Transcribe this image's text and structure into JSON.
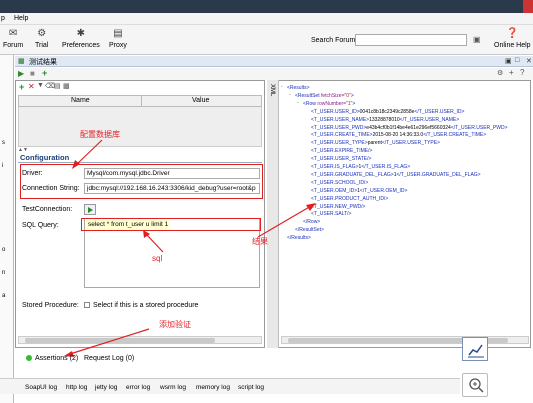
{
  "menu": {
    "item_fragment": "p",
    "help": "Help"
  },
  "toolbar": {
    "forum": "Forum",
    "trial": "Trial",
    "preferences": "Preferences",
    "proxy": "Proxy",
    "search_label": "Search Forum",
    "online_help": "Online Help"
  },
  "left_strip": [
    "s",
    "i",
    "o",
    "n",
    "a"
  ],
  "jdbc_window": {
    "title": "测试结果",
    "properties": {
      "col_name": "Name",
      "col_value": "Value"
    },
    "configuration_title": "Configuration",
    "driver_label": "Driver:",
    "driver_value": "Mysql/com.mysql.jdbc.Driver",
    "connection_label": "Connection String:",
    "connection_value": "jdbc:mysql://192.168.16.243:3306/kid_debug?user=root&p",
    "test_connection_label": "TestConnection:",
    "sql_label": "SQL Query:",
    "sql_value": "select * from t_user u limit 1",
    "stored_procedure_label": "Stored Procedure:",
    "stored_procedure_text": "Select if this is a stored procedure"
  },
  "xml_panel": {
    "tab_label": "XML",
    "lines": [
      {
        "indent": 0,
        "open": "<Results>",
        "exp": "-"
      },
      {
        "indent": 1,
        "open": "<ResultSet ",
        "attr": "fetchSize",
        "val": "\"0\"",
        "close": ">",
        "exp": "-"
      },
      {
        "indent": 2,
        "open": "<Row ",
        "attr": "rowNumber",
        "val": "\"1\"",
        "close": ">",
        "exp": "-"
      },
      {
        "indent": 3,
        "open": "<T_USER.USER_ID>",
        "text": "0041c8b18c2349c2858e",
        "close": "</T_USER.USER_ID>"
      },
      {
        "indent": 3,
        "open": "<T_USER.USER_NAME>",
        "text": "13328878010",
        "close": "</T_USER.USER_NAME>"
      },
      {
        "indent": 3,
        "open": "<T_USER.USER_PWD>",
        "text": "e43b4cf0b1f14be4e61e296ef5660324",
        "close": "</T_USER.USER_PWD>"
      },
      {
        "indent": 3,
        "open": "<T_USER.CREATE_TIME>",
        "text": "2015-08-20 14:36:33.0",
        "close": "</T_USER.CREATE_TIME>"
      },
      {
        "indent": 3,
        "open": "<T_USER.USER_TYPE>",
        "text": "parent",
        "close": "</T_USER.USER_TYPE>"
      },
      {
        "indent": 3,
        "open": "<T_USER.EXPIRE_TIME/>"
      },
      {
        "indent": 3,
        "open": "<T_USER.USER_STATE/>"
      },
      {
        "indent": 3,
        "open": "<T_USER.IS_FLAG>",
        "text": "1",
        "close": "</T_USER.IS_FLAG>"
      },
      {
        "indent": 3,
        "open": "<T_USER.GRADUATE_DEL_FLAG>",
        "text": "1",
        "close": "</T_USER.GRADUATE_DEL_FLAG>"
      },
      {
        "indent": 3,
        "open": "<T_USER.SCHOOL_ID/>"
      },
      {
        "indent": 3,
        "open": "<T_USER.OEM_ID>",
        "text": "1",
        "close": "</T_USER.OEM_ID>"
      },
      {
        "indent": 3,
        "open": "<T_USER.PRODUCT_AUTH_ID/>"
      },
      {
        "indent": 3,
        "open": "<T_USER.NEW_PWD/>"
      },
      {
        "indent": 3,
        "open": "<T_USER.SALT/>"
      },
      {
        "indent": 2,
        "open": "</Row>"
      },
      {
        "indent": 1,
        "open": "</ResultSet>"
      },
      {
        "indent": 0,
        "open": "</Results>"
      }
    ]
  },
  "annotations": {
    "config_db": "配置数据库",
    "sql": "sql",
    "result": "结果",
    "add_assertion": "添加验证"
  },
  "bottom": {
    "assertions": "Assertions (2)",
    "request_log": "Request Log (0)"
  },
  "log_tabs": [
    "SoapUI log",
    "http log",
    "jetty log",
    "error log",
    "wsrm log",
    "memory log",
    "script log"
  ],
  "colors": {
    "annotation": "#e0242b",
    "xml_tag": "#1a2fb8",
    "xml_attr_value": "#b02020",
    "assertion_ok": "#33bb33"
  }
}
